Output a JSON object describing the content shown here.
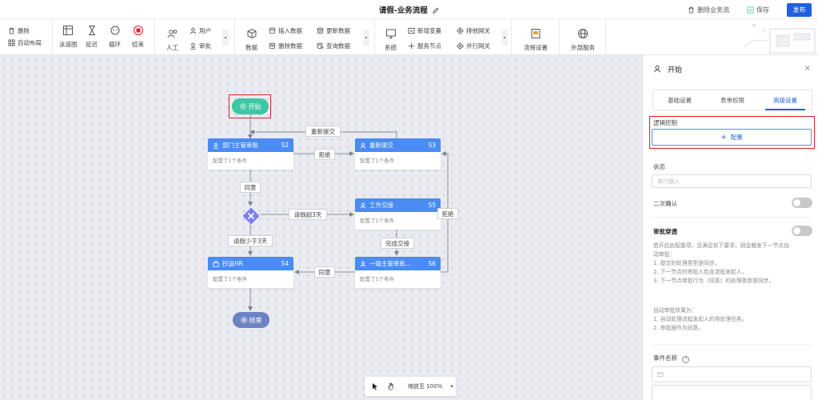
{
  "header": {
    "title": "请假-业务流程",
    "delete_flow": "删除业务流",
    "save": "保存",
    "publish": "发布"
  },
  "toolbar": {
    "delete": "删除",
    "auto_layout": "自动布局",
    "swimlane": "泳道图",
    "delay": "延迟",
    "loop": "循环",
    "end": "结束",
    "manual": "人工",
    "user": "用户",
    "approve": "审批",
    "data": "数据",
    "insert_data": "插入数据",
    "delete_data": "删除数据",
    "update_data": "更新数据",
    "query_data": "查询数据",
    "system": "系统",
    "add_variable": "新增变量",
    "service_node": "服务节点",
    "exclusive_gateway": "排他网关",
    "parallel_gateway": "并行网关",
    "flow_settings": "流程设置",
    "external_service": "外部服务"
  },
  "flow": {
    "start": "开始",
    "end": "结束",
    "nodes": [
      {
        "title": "部门主管审批",
        "code": "S2",
        "desc": "配置了1个条件"
      },
      {
        "title": "重新提交",
        "code": "S3",
        "desc": "配置了1个条件"
      },
      {
        "title": "工作交接",
        "code": "S5",
        "desc": "配置了1个条件"
      },
      {
        "title": "抄送HR",
        "code": "S4",
        "desc": "配置了1个条件"
      },
      {
        "title": "一级主管审批...",
        "code": "S6",
        "desc": "配置了1个条件"
      }
    ],
    "edges": {
      "resubmit": "重新提交",
      "reject1": "拒绝",
      "agree1": "同意",
      "leave_over_3": "请假超3天",
      "reject2": "拒绝",
      "leave_under_3": "请假少于3天",
      "handover_done": "完成交接",
      "agree2": "同意"
    }
  },
  "zoom": {
    "label": "缩放至 100%"
  },
  "panel": {
    "title": "开始",
    "tabs": [
      "基础设置",
      "表单权限",
      "高级设置"
    ],
    "active_tab": "高级设置",
    "logic_control": "逻辑控制",
    "config_button": "配置",
    "status_label": "状态",
    "status_placeholder": "单行输入",
    "second_confirm": "二次确认",
    "approval_passthrough": "审批穿透",
    "passthrough_desc": [
      "若开启此配置项，且满足如下要求，则会触发下一节点自",
      "动审批：",
      "1. 提交的处理类型是同步。",
      "2. 下一节点的审批人包含流程发起人。",
      "3. 下一节点审批行为（同意）的处理类型是同步。"
    ],
    "effect_desc": [
      "自动审批效果为：",
      "1. 自动处理流程发起人的待处理任务。",
      "2. 审批操作为同意。"
    ],
    "event_name": "事件名称"
  },
  "colors": {
    "accent": "#1f5fe0",
    "node_header": "#4a8cf3",
    "start": "#3ec7a4",
    "end": "#6b83c2",
    "gateway": "#7c7ef0",
    "highlight": "#e0202b"
  }
}
